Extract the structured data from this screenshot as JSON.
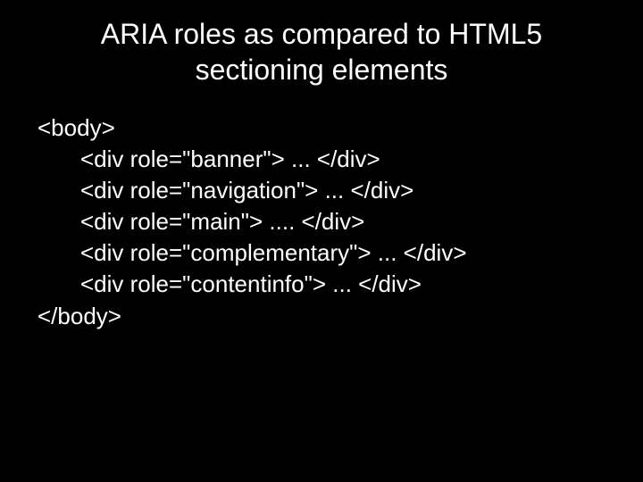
{
  "title_line1": "ARIA roles as compared to HTML5",
  "title_line2": "sectioning elements",
  "code": {
    "l0": "<body>",
    "l1": "<div role=\"banner\"> ... </div>",
    "l2": "<div role=\"navigation\"> ... </div>",
    "l3": "<div role=\"main\"> .... </div>",
    "l4": "<div role=\"complementary\"> ... </div>",
    "l5": "<div role=\"contentinfo\"> ... </div>",
    "l6": "</body>"
  }
}
